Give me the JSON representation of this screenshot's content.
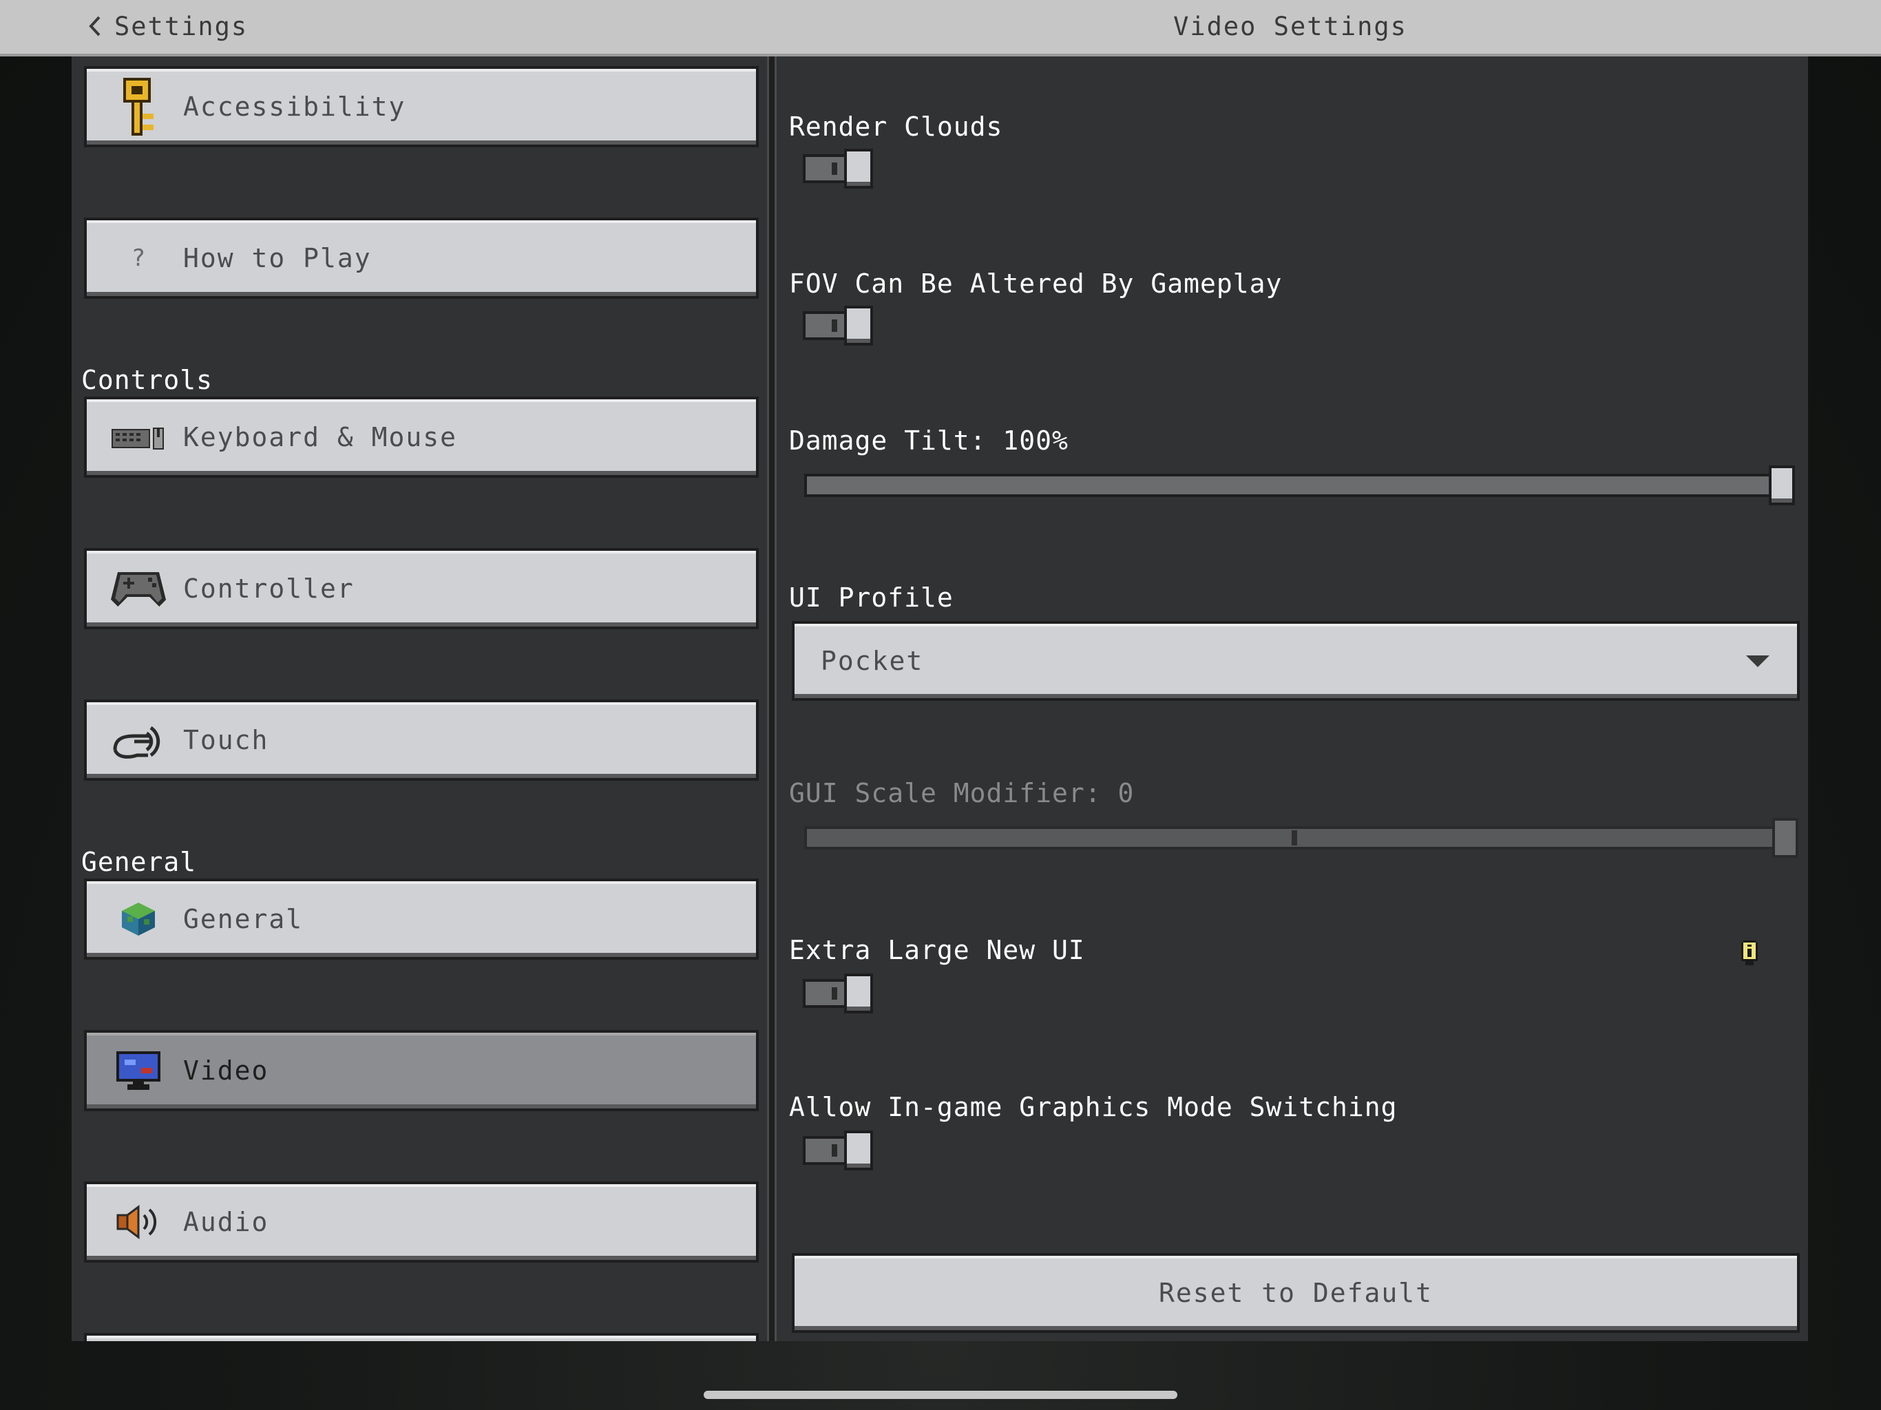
{
  "header": {
    "back_label": "Settings",
    "title": "Video Settings"
  },
  "sidebar": {
    "items": [
      {
        "label": "Accessibility",
        "icon": "key-icon"
      },
      {
        "label": "How to Play",
        "icon": "question-icon"
      },
      {
        "label": "Keyboard & Mouse",
        "icon": "keyboard-mouse-icon"
      },
      {
        "label": "Controller",
        "icon": "gamepad-icon"
      },
      {
        "label": "Touch",
        "icon": "touch-icon"
      },
      {
        "label": "General",
        "icon": "grass-block-icon"
      },
      {
        "label": "Video",
        "icon": "monitor-icon",
        "selected": true
      },
      {
        "label": "Audio",
        "icon": "speaker-icon"
      }
    ],
    "sections": {
      "controls": "Controls",
      "general": "General"
    }
  },
  "settings": {
    "render_clouds": {
      "label": "Render Clouds",
      "on": false
    },
    "fov_altered": {
      "label": "FOV Can Be Altered By Gameplay",
      "on": false
    },
    "damage_tilt": {
      "label": "Damage Tilt: 100%",
      "value_percent": 100
    },
    "ui_profile": {
      "label": "UI Profile",
      "value": "Pocket"
    },
    "gui_scale": {
      "label": "GUI Scale Modifier: 0",
      "value": 0,
      "disabled": true
    },
    "extra_large_ui": {
      "label": "Extra Large New UI",
      "on": false,
      "icon": "info-icon"
    },
    "graphics_mode_switching": {
      "label": "Allow In-game Graphics Mode Switching",
      "on": false
    },
    "reset_label": "Reset to Default"
  },
  "colors": {
    "button_face": "#d0d1d4",
    "panel": "#313233",
    "selected_button": "#8c8d90",
    "header": "#c6c6c6"
  }
}
